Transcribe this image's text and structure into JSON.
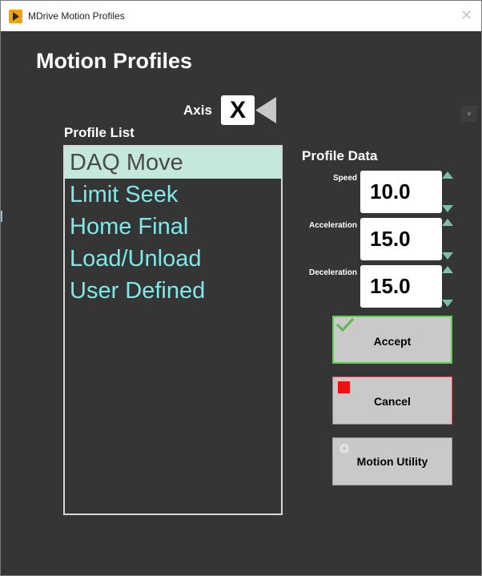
{
  "window": {
    "title": "MDrive Motion Profiles",
    "close_glyph": "✕",
    "icon": "labview-run-icon"
  },
  "page": {
    "heading": "Motion Profiles"
  },
  "axis": {
    "label": "Axis",
    "value": "X"
  },
  "profile_list": {
    "label": "Profile List",
    "items": [
      "DAQ Move",
      "Limit Seek",
      "Home Final",
      "Load/Unload",
      "User Defined"
    ],
    "selected_index": 0
  },
  "profile_data": {
    "label": "Profile Data",
    "speed": {
      "label": "Speed",
      "value": "10.0"
    },
    "acceleration": {
      "label": "Acceleration",
      "value": "15.0"
    },
    "deceleration": {
      "label": "Deceleration",
      "value": "15.0"
    }
  },
  "buttons": {
    "accept": {
      "label": "Accept",
      "icon": "checkmark-icon"
    },
    "cancel": {
      "label": "Cancel",
      "icon": "stop-square-icon"
    },
    "motion_utility": {
      "label": "Motion Utility",
      "icon": "gear-icon"
    }
  },
  "colors": {
    "background": "#353535",
    "list_text": "#7fe8e8",
    "selected_row": "#c5e8dc",
    "accept_border": "#5fcf4f",
    "cancel_border": "#d06070",
    "spinner": "#7fbfa8"
  }
}
